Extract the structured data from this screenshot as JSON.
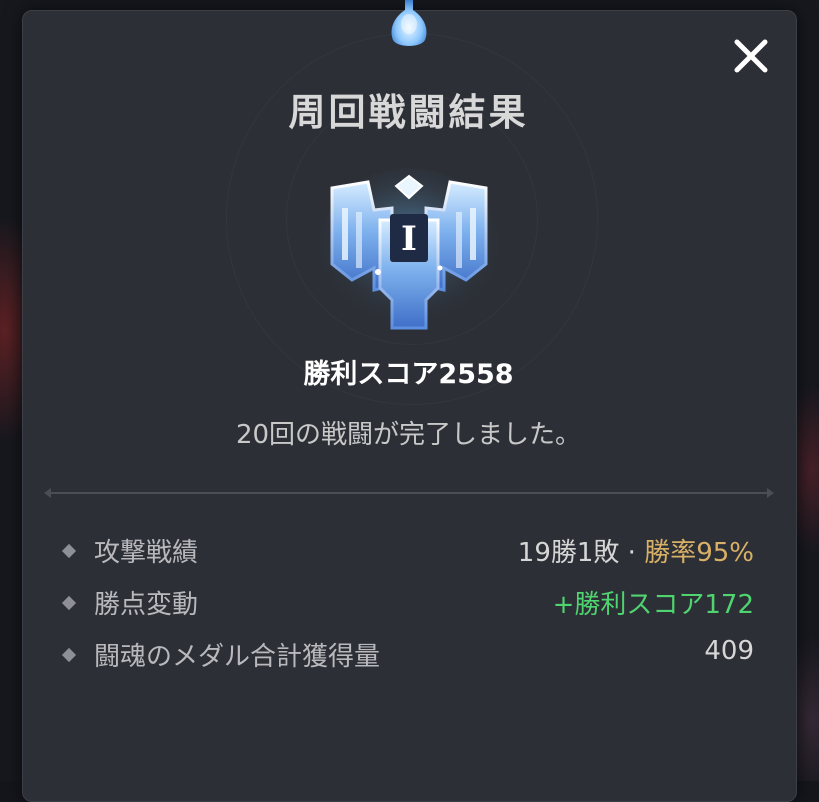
{
  "dialog": {
    "title": "周回戦闘結果",
    "score_text": "勝利スコア2558",
    "completion_text": "20回の戦闘が完了しました。",
    "emblem_icon": "rank-emblem-icon",
    "emblem_rank": "I",
    "close_icon": "close-icon"
  },
  "stats": [
    {
      "label": "攻撃戦績",
      "value_main": "19勝1敗 · ",
      "value_accent": "勝率95%",
      "accent_color": "#d8b067"
    },
    {
      "label": "勝点変動",
      "value_accent": "+勝利スコア172",
      "accent_color": "#4fd46f"
    },
    {
      "label": "闘魂のメダル合計獲得量",
      "value_main": "409"
    }
  ]
}
